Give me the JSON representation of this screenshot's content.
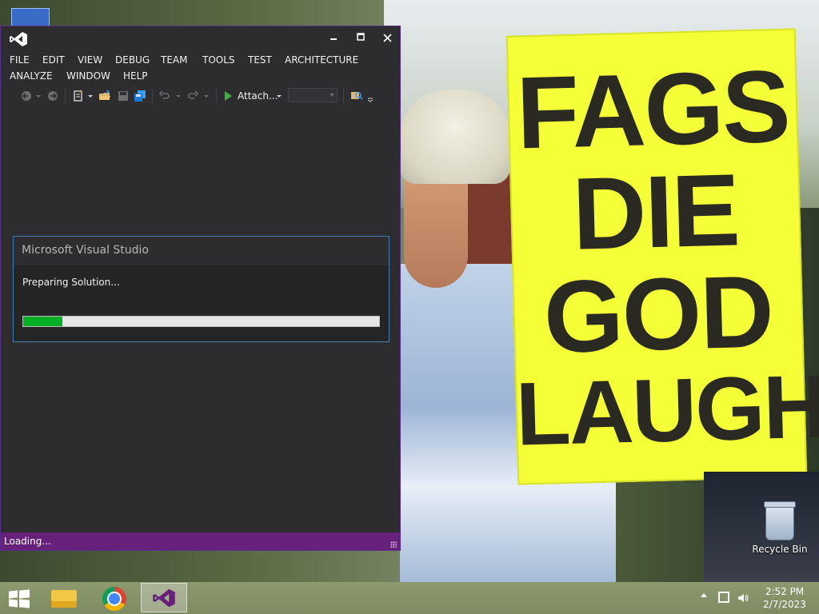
{
  "vs": {
    "menu_row1": [
      "FILE",
      "EDIT",
      "VIEW",
      "DEBUG",
      "TEAM",
      "TOOLS",
      "TEST",
      "ARCHITECTURE"
    ],
    "menu_row2": [
      "ANALYZE",
      "WINDOW",
      "HELP"
    ],
    "toolbar": {
      "attach_label": "Attach..."
    },
    "dialog": {
      "title": "Microsoft Visual Studio",
      "status": "Preparing Solution...",
      "progress_percent": 11
    },
    "statusbar": {
      "text": "Loading..."
    },
    "accent_color": "#68217a",
    "progress_color": "#06b025"
  },
  "wallpaper": {
    "sign_lines": [
      "FAGS",
      "DIE",
      "GOD",
      "LAUGHS"
    ]
  },
  "desktop": {
    "recycle_bin_label": "Recycle Bin"
  },
  "taskbar": {
    "pinned": [
      "windows-start-icon",
      "file-explorer-icon",
      "chrome-icon",
      "visual-studio-icon"
    ],
    "clock_time": "2:52 PM",
    "clock_date": "2/7/2023"
  }
}
